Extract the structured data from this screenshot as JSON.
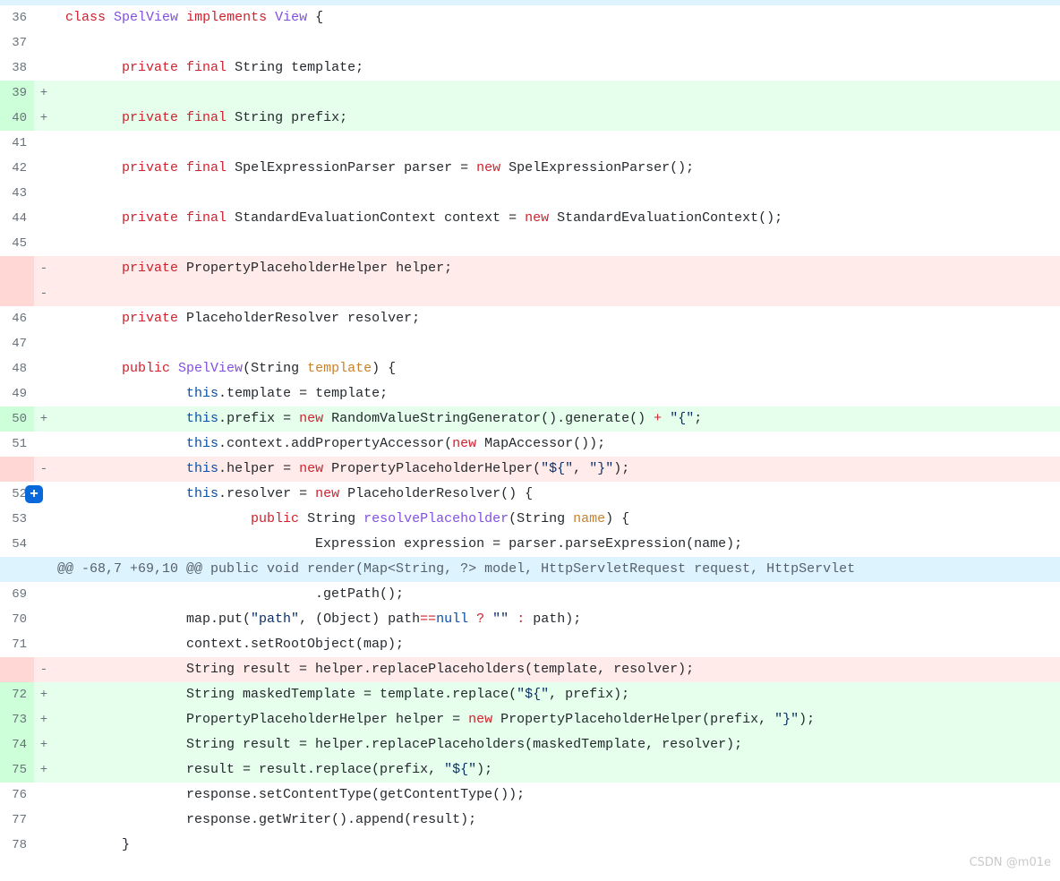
{
  "hunk_header": "@@ -68,7 +69,10 @@ public void render(Map<String, ?> model, HttpServletRequest request, HttpServlet",
  "watermark": "CSDN @m01e",
  "lines": [
    {
      "num": "36",
      "sign": "",
      "type": "ctx",
      "tokens": [
        [
          " ",
          ""
        ],
        [
          "class",
          "kw"
        ],
        [
          " ",
          ""
        ],
        [
          "SpelView",
          "type"
        ],
        [
          " ",
          ""
        ],
        [
          "implements",
          "kw"
        ],
        [
          " ",
          ""
        ],
        [
          "View",
          "type"
        ],
        [
          " {",
          ""
        ]
      ]
    },
    {
      "num": "37",
      "sign": "",
      "type": "ctx",
      "tokens": [
        [
          "",
          ""
        ]
      ]
    },
    {
      "num": "38",
      "sign": "",
      "type": "ctx",
      "tokens": [
        [
          "        ",
          ""
        ],
        [
          "private",
          "kw"
        ],
        [
          " ",
          ""
        ],
        [
          "final",
          "kw"
        ],
        [
          " String template;",
          ""
        ]
      ]
    },
    {
      "num": "39",
      "sign": "+",
      "type": "add",
      "tokens": [
        [
          "",
          ""
        ]
      ]
    },
    {
      "num": "40",
      "sign": "+",
      "type": "add",
      "tokens": [
        [
          "        ",
          ""
        ],
        [
          "private",
          "kw"
        ],
        [
          " ",
          ""
        ],
        [
          "final",
          "kw"
        ],
        [
          " String prefix;",
          ""
        ]
      ]
    },
    {
      "num": "41",
      "sign": "",
      "type": "ctx",
      "tokens": [
        [
          "",
          ""
        ]
      ]
    },
    {
      "num": "42",
      "sign": "",
      "type": "ctx",
      "tokens": [
        [
          "        ",
          ""
        ],
        [
          "private",
          "kw"
        ],
        [
          " ",
          ""
        ],
        [
          "final",
          "kw"
        ],
        [
          " SpelExpressionParser parser = ",
          ""
        ],
        [
          "new",
          "kw"
        ],
        [
          " SpelExpressionParser();",
          ""
        ]
      ]
    },
    {
      "num": "43",
      "sign": "",
      "type": "ctx",
      "tokens": [
        [
          "",
          ""
        ]
      ]
    },
    {
      "num": "44",
      "sign": "",
      "type": "ctx",
      "tokens": [
        [
          "        ",
          ""
        ],
        [
          "private",
          "kw"
        ],
        [
          " ",
          ""
        ],
        [
          "final",
          "kw"
        ],
        [
          " StandardEvaluationContext context = ",
          ""
        ],
        [
          "new",
          "kw"
        ],
        [
          " StandardEvaluationContext();",
          ""
        ]
      ]
    },
    {
      "num": "45",
      "sign": "",
      "type": "ctx",
      "tokens": [
        [
          "",
          ""
        ]
      ]
    },
    {
      "num": "",
      "sign": "-",
      "type": "del",
      "tokens": [
        [
          "        ",
          ""
        ],
        [
          "private",
          "kw"
        ],
        [
          " PropertyPlaceholderHelper helper;",
          ""
        ]
      ]
    },
    {
      "num": "",
      "sign": "-",
      "type": "del",
      "tokens": [
        [
          "",
          ""
        ]
      ]
    },
    {
      "num": "46",
      "sign": "",
      "type": "ctx",
      "tokens": [
        [
          "        ",
          ""
        ],
        [
          "private",
          "kw"
        ],
        [
          " PlaceholderResolver resolver;",
          ""
        ]
      ]
    },
    {
      "num": "47",
      "sign": "",
      "type": "ctx",
      "tokens": [
        [
          "",
          ""
        ]
      ]
    },
    {
      "num": "48",
      "sign": "",
      "type": "ctx",
      "tokens": [
        [
          "        ",
          ""
        ],
        [
          "public",
          "kw"
        ],
        [
          " ",
          ""
        ],
        [
          "SpelView",
          "fn"
        ],
        [
          "(String ",
          ""
        ],
        [
          "template",
          "param"
        ],
        [
          ") {",
          ""
        ]
      ]
    },
    {
      "num": "49",
      "sign": "",
      "type": "ctx",
      "tokens": [
        [
          "                ",
          ""
        ],
        [
          "this",
          "this"
        ],
        [
          ".",
          ""
        ],
        [
          "template",
          ""
        ],
        [
          " = template;",
          ""
        ]
      ]
    },
    {
      "num": "50",
      "sign": "+",
      "type": "add",
      "tokens": [
        [
          "                ",
          ""
        ],
        [
          "this",
          "this"
        ],
        [
          ".",
          ""
        ],
        [
          "prefix",
          ""
        ],
        [
          " = ",
          ""
        ],
        [
          "new",
          "kw"
        ],
        [
          " RandomValueStringGenerator().generate() ",
          ""
        ],
        [
          "+",
          "op"
        ],
        [
          " ",
          ""
        ],
        [
          "\"{\"",
          "str"
        ],
        [
          ";",
          ""
        ]
      ]
    },
    {
      "num": "51",
      "sign": "",
      "type": "ctx",
      "tokens": [
        [
          "                ",
          ""
        ],
        [
          "this",
          "this"
        ],
        [
          ".",
          ""
        ],
        [
          "context",
          ""
        ],
        [
          ".addPropertyAccessor(",
          ""
        ],
        [
          "new",
          "kw"
        ],
        [
          " MapAccessor());",
          ""
        ]
      ]
    },
    {
      "num": "",
      "sign": "-",
      "type": "del",
      "tokens": [
        [
          "                ",
          ""
        ],
        [
          "this",
          "this"
        ],
        [
          ".",
          ""
        ],
        [
          "helper",
          ""
        ],
        [
          " = ",
          ""
        ],
        [
          "new",
          "kw"
        ],
        [
          " PropertyPlaceholderHelper(",
          ""
        ],
        [
          "\"${\"",
          "str"
        ],
        [
          ", ",
          ""
        ],
        [
          "\"}\"",
          "str"
        ],
        [
          ");",
          ""
        ]
      ]
    },
    {
      "num": "52",
      "sign": "",
      "type": "ctx",
      "plusbtn": true,
      "tokens": [
        [
          "                ",
          ""
        ],
        [
          "this",
          "this"
        ],
        [
          ".",
          ""
        ],
        [
          "resolver",
          ""
        ],
        [
          " = ",
          ""
        ],
        [
          "new",
          "kw"
        ],
        [
          " PlaceholderResolver() {",
          ""
        ]
      ]
    },
    {
      "num": "53",
      "sign": "",
      "type": "ctx",
      "tokens": [
        [
          "                        ",
          ""
        ],
        [
          "public",
          "kw"
        ],
        [
          " String ",
          ""
        ],
        [
          "resolvePlaceholder",
          "fn"
        ],
        [
          "(String ",
          ""
        ],
        [
          "name",
          "param"
        ],
        [
          ") {",
          ""
        ]
      ]
    },
    {
      "num": "54",
      "sign": "",
      "type": "ctx",
      "tokens": [
        [
          "                                Expression expression = parser.parseExpression(name);",
          ""
        ]
      ]
    },
    {
      "type": "hunk"
    },
    {
      "num": "69",
      "sign": "",
      "type": "ctx",
      "tokens": [
        [
          "                                .getPath();",
          ""
        ]
      ]
    },
    {
      "num": "70",
      "sign": "",
      "type": "ctx",
      "tokens": [
        [
          "                map.put(",
          ""
        ],
        [
          "\"path\"",
          "str"
        ],
        [
          ", (Object) path",
          ""
        ],
        [
          "==",
          "op"
        ],
        [
          "null",
          "this"
        ],
        [
          " ",
          ""
        ],
        [
          "?",
          "op"
        ],
        [
          " ",
          ""
        ],
        [
          "\"\"",
          "str"
        ],
        [
          " ",
          ""
        ],
        [
          ":",
          "op"
        ],
        [
          " path);",
          ""
        ]
      ]
    },
    {
      "num": "71",
      "sign": "",
      "type": "ctx",
      "tokens": [
        [
          "                context.setRootObject(map);",
          ""
        ]
      ]
    },
    {
      "num": "",
      "sign": "-",
      "type": "del",
      "tokens": [
        [
          "                String result = helper.replacePlaceholders(template, resolver);",
          ""
        ]
      ]
    },
    {
      "num": "72",
      "sign": "+",
      "type": "add",
      "tokens": [
        [
          "                String maskedTemplate = template.replace(",
          ""
        ],
        [
          "\"${\"",
          "str"
        ],
        [
          ", prefix);",
          ""
        ]
      ]
    },
    {
      "num": "73",
      "sign": "+",
      "type": "add",
      "tokens": [
        [
          "                PropertyPlaceholderHelper helper = ",
          ""
        ],
        [
          "new",
          "kw"
        ],
        [
          " PropertyPlaceholderHelper(prefix, ",
          ""
        ],
        [
          "\"}\"",
          "str"
        ],
        [
          ");",
          ""
        ]
      ]
    },
    {
      "num": "74",
      "sign": "+",
      "type": "add",
      "tokens": [
        [
          "                String result = helper.replacePlaceholders(maskedTemplate, resolver);",
          ""
        ]
      ]
    },
    {
      "num": "75",
      "sign": "+",
      "type": "add",
      "tokens": [
        [
          "                result = result.replace(prefix, ",
          ""
        ],
        [
          "\"${\"",
          "str"
        ],
        [
          ");",
          ""
        ]
      ]
    },
    {
      "num": "76",
      "sign": "",
      "type": "ctx",
      "tokens": [
        [
          "                response.setContentType(getContentType());",
          ""
        ]
      ]
    },
    {
      "num": "77",
      "sign": "",
      "type": "ctx",
      "tokens": [
        [
          "                response.getWriter().append(result);",
          ""
        ]
      ]
    },
    {
      "num": "78",
      "sign": "",
      "type": "ctx",
      "tokens": [
        [
          "        }",
          ""
        ]
      ]
    }
  ]
}
